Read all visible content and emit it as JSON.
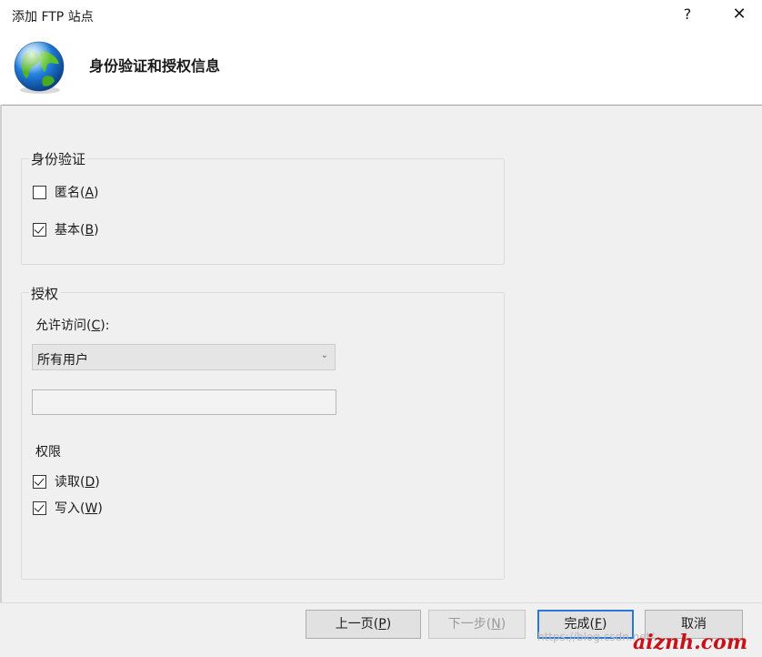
{
  "window": {
    "title": "添加 FTP 站点",
    "help_label": "?",
    "close_label": "✕"
  },
  "header": {
    "title": "身份验证和授权信息",
    "icon": "globe-icon"
  },
  "authentication": {
    "group_label": "身份验证",
    "anonymous": {
      "label": "匿名",
      "mnemonic": "A",
      "checked": false
    },
    "basic": {
      "label": "基本",
      "mnemonic": "B",
      "checked": true
    }
  },
  "authorization": {
    "group_label": "授权",
    "allow_access_label": "允许访问",
    "allow_access_mnemonic": "C",
    "allow_access_value": "所有用户",
    "textbox_value": "",
    "permissions_label": "权限",
    "read": {
      "label": "读取",
      "mnemonic": "D",
      "checked": true
    },
    "write": {
      "label": "写入",
      "mnemonic": "W",
      "checked": true
    }
  },
  "buttons": {
    "previous": {
      "label": "上一页",
      "mnemonic": "P"
    },
    "next": {
      "label": "下一步",
      "mnemonic": "N"
    },
    "finish": {
      "label": "完成",
      "mnemonic": "F"
    },
    "cancel": {
      "label": "取消"
    }
  },
  "watermark": {
    "url_text": "https://blog.csdn.net/...",
    "brand_text": "aiznh.com"
  },
  "colors": {
    "accent": "#2a78d4",
    "watermark_brand": "#c9111a"
  }
}
